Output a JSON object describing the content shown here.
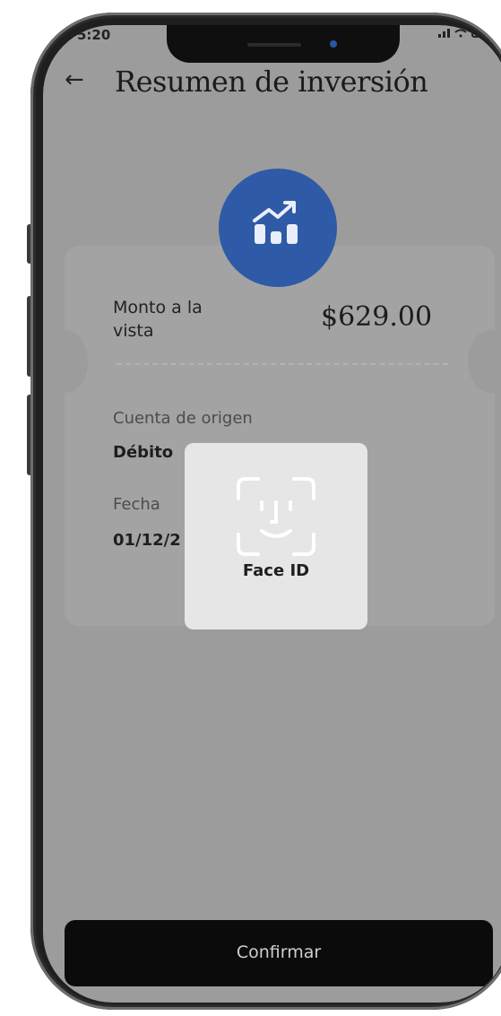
{
  "status_bar": {
    "time": "5:20"
  },
  "header": {
    "back_icon": "arrow-left-icon",
    "title": "Resumen de inversión"
  },
  "summary": {
    "icon": "investment-chart-icon",
    "amount_label": "Monto a la vista",
    "amount": "$629.00",
    "origin_label": "Cuenta de origen",
    "origin_value": "Débito",
    "date_label": "Fecha",
    "date_value": "01/12/2"
  },
  "faceid": {
    "icon": "face-id-icon",
    "label": "Face ID"
  },
  "footer": {
    "confirm_label": "Confirmar"
  },
  "colors": {
    "accent": "#2e5aa7",
    "button": "#0b0b0b",
    "overlay": "#9c9c9c"
  }
}
